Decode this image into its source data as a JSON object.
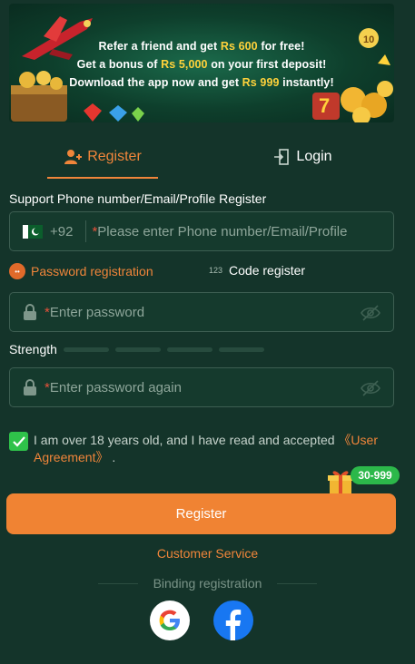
{
  "banner": {
    "line1_a": "Refer a friend and get ",
    "line1_b": "Rs 600",
    "line1_c": " for free!",
    "line2_a": "Get a bonus of ",
    "line2_b": "Rs 5,000",
    "line2_c": " on your first deposit!",
    "line3_a": "Download the app now and get ",
    "line3_b": "Rs 999",
    "line3_c": " instantly!"
  },
  "tabs": [
    {
      "label": "Register",
      "icon": "add-user-icon",
      "active": true
    },
    {
      "label": "Login",
      "icon": "login-door-icon",
      "active": false
    }
  ],
  "form": {
    "section_label": "Support Phone number/Email/Profile Register",
    "country_code": "+92",
    "phone_placeholder": "Please enter Phone number/Email/Profile",
    "mode_password": "Password registration",
    "mode_code_icon": "123",
    "mode_code": "Code register",
    "password_placeholder": "Enter password",
    "strength_label": "Strength",
    "password_again_placeholder": "Enter password again",
    "required_mark": "*"
  },
  "agreement": {
    "text": "I am over 18 years old, and I have read and accepted ",
    "link": "《User Agreement》",
    "end": " .",
    "checked": true
  },
  "gift_badge": "30-999",
  "register_button": "Register",
  "customer_service": "Customer Service",
  "binding_label": "Binding registration",
  "colors": {
    "background": "#14342a",
    "accent": "#f0853a",
    "check": "#2fc24a",
    "facebook": "#1877f2"
  }
}
